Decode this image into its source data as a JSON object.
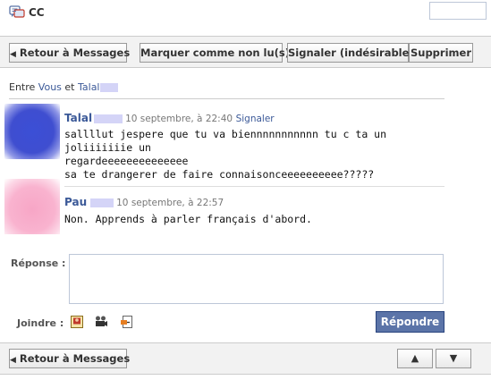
{
  "header": {
    "title": "CC",
    "icon": "chat-messages-icon"
  },
  "toolbar_top": {
    "back_label": "Retour à Messages",
    "mark_unread_label": "Marquer comme non lu(s)",
    "report_spam_label": "Signaler (indésirable)",
    "delete_label": "Supprimer"
  },
  "between": {
    "prefix": "Entre",
    "you": "Vous",
    "and": "et",
    "other": "Talal"
  },
  "messages": [
    {
      "sender": "Talal",
      "date": "10 septembre, à 22:40",
      "report": "Signaler",
      "lines": [
        "sallllut jespere que tu va biennnnnnnnnnn tu c ta un joliiiiiiie un",
        "regardeeeeeeeeeeeeee",
        "sa te drangerer de faire connaisonceeeeeeeeee?????"
      ]
    },
    {
      "sender": "Pau",
      "date": "10 septembre, à 22:57",
      "lines": [
        "Non. Apprends à parler français d'abord."
      ]
    }
  ],
  "reply": {
    "label": "Réponse :",
    "value": "",
    "attach_label": "Joindre :",
    "attach_icons": [
      "photo-icon",
      "video-icon",
      "share-link-icon"
    ],
    "submit_label": "Répondre"
  },
  "toolbar_bottom": {
    "back_label": "Retour à Messages",
    "prev_symbol": "▲",
    "next_symbol": "▼"
  },
  "colors": {
    "link": "#3b5998",
    "button_primary": "#5b74a8",
    "toolbar_bg": "#f2f2f2"
  }
}
